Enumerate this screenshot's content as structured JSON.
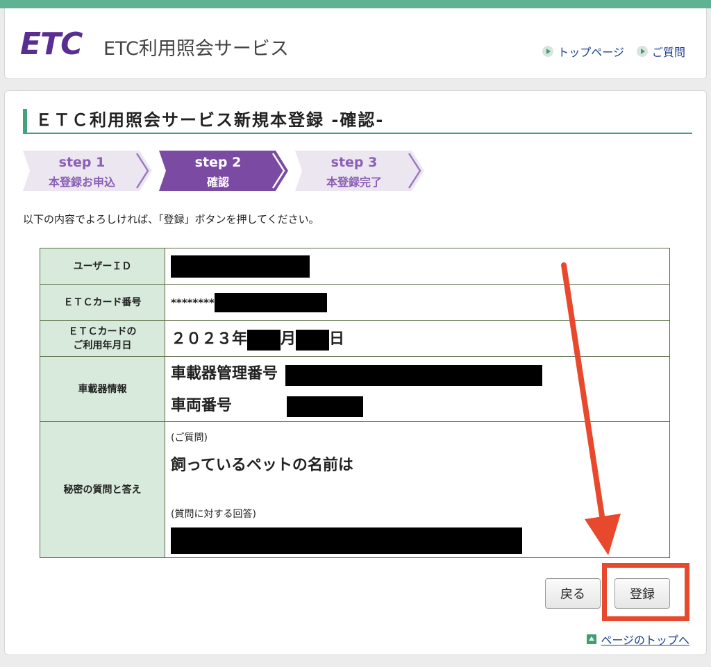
{
  "header": {
    "logo_text": "ETC",
    "site_title": "ETC利用照会サービス",
    "nav": [
      {
        "label": "トップページ"
      },
      {
        "label": "ご質問"
      }
    ]
  },
  "page": {
    "title": "ＥＴＣ利用照会サービス新規本登録 -確認-",
    "steps": [
      {
        "line1": "step 1",
        "line2": "本登録お申込",
        "state": "inactive"
      },
      {
        "line1": "step 2",
        "line2": "確認",
        "state": "active"
      },
      {
        "line1": "step 3",
        "line2": "本登録完了",
        "state": "inactive"
      }
    ],
    "intro": "以下の内容でよろしければ、「登録」ボタンを押してください。"
  },
  "table": {
    "user_id_label": "ユーザーＩＤ",
    "card_no_label": "ＥＴＣカード番号",
    "card_no_prefix": "********",
    "use_date_label_1": "ＥＴＣカードの",
    "use_date_label_2": "ご利用年月日",
    "use_date_year": "２０２３年",
    "use_date_month": "月",
    "use_date_day": "日",
    "vehicle_label": "車載器情報",
    "vehicle_mgmt_label": "車載器管理番号",
    "vehicle_no_label": "車両番号",
    "secret_label": "秘密の質問と答え",
    "question_caption": "(ご質問)",
    "question_text": "飼っているペットの名前は",
    "answer_caption": "(質問に対する回答)"
  },
  "buttons": {
    "back": "戻る",
    "register": "登録"
  },
  "footer": {
    "page_top": "ページのトップへ"
  },
  "colors": {
    "brand": "#5a2d91",
    "accent_green": "#44a27c",
    "label_bg": "#d7eadb",
    "step_inactive_bg": "#ece6f1",
    "step_active_bg": "#7b4aa3",
    "annotation_red": "#e8492d"
  }
}
